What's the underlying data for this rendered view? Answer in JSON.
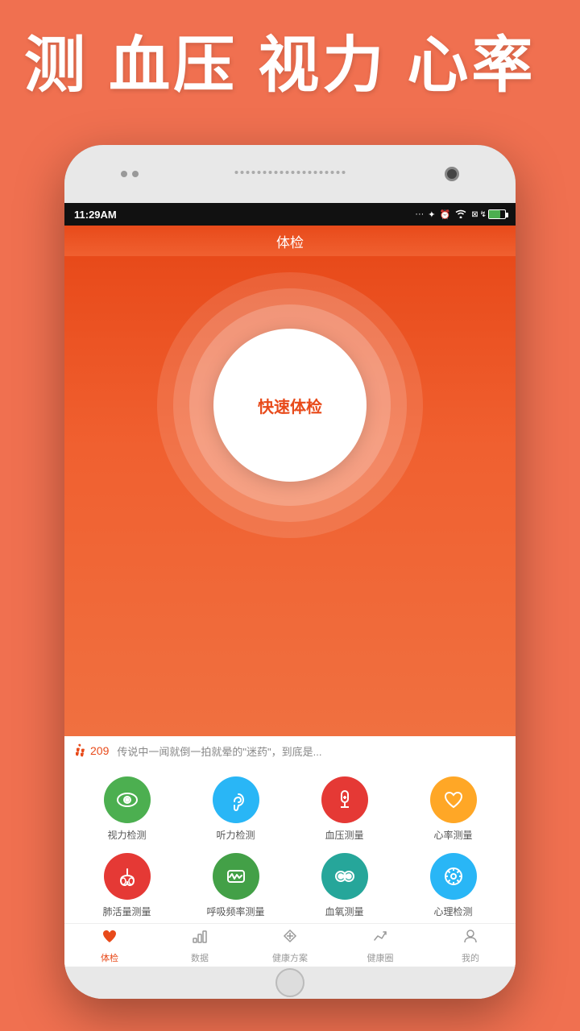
{
  "hero": {
    "title": "测 血压 视力 心率"
  },
  "status_bar": {
    "time": "11:29AM",
    "icons": "... ✦ ⏰ ⊙ ⊠ ↯ ▮"
  },
  "app_header": {
    "title": "体检"
  },
  "quick_exam": {
    "label": "快速体检"
  },
  "ticker": {
    "steps": "209",
    "news": "传说中一闻就倒一拍就晕的\"迷药\"，到底是..."
  },
  "features": [
    {
      "id": "vision",
      "label": "视力检测",
      "color": "icon-green",
      "icon": "eye"
    },
    {
      "id": "hearing",
      "label": "听力检测",
      "color": "icon-blue",
      "icon": "ear"
    },
    {
      "id": "blood-pressure",
      "label": "血压测量",
      "color": "icon-red",
      "icon": "thermometer"
    },
    {
      "id": "heart-rate",
      "label": "心率测量",
      "color": "icon-orange",
      "icon": "heart"
    },
    {
      "id": "lung",
      "label": "肺活量测量",
      "color": "icon-pink-red",
      "icon": "lungs"
    },
    {
      "id": "breathing",
      "label": "呼吸频率测量",
      "color": "icon-green2",
      "icon": "ecg"
    },
    {
      "id": "blood-oxygen",
      "label": "血氧测量",
      "color": "icon-green3",
      "icon": "binoculars"
    },
    {
      "id": "psychology",
      "label": "心理检测",
      "color": "icon-blue2",
      "icon": "gear"
    }
  ],
  "bottom_nav": [
    {
      "id": "exam",
      "label": "体检",
      "active": true
    },
    {
      "id": "data",
      "label": "数据",
      "active": false
    },
    {
      "id": "health-plan",
      "label": "健康方案",
      "active": false
    },
    {
      "id": "health-circle",
      "label": "健康圈",
      "active": false
    },
    {
      "id": "mine",
      "label": "我的",
      "active": false
    }
  ]
}
